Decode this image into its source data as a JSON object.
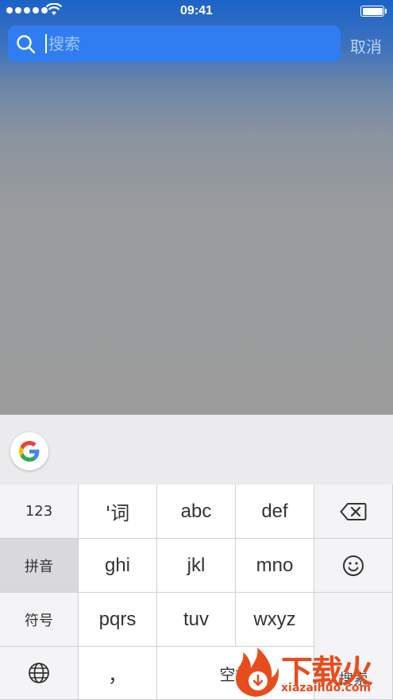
{
  "status_bar": {
    "time": "09:41"
  },
  "search": {
    "placeholder": "搜索",
    "value": "",
    "cancel_label": "取消"
  },
  "keyboard": {
    "rows": [
      [
        "123",
        "'词",
        "abc",
        "def"
      ],
      [
        "拼音",
        "ghi",
        "jkl",
        "mno"
      ],
      [
        "符号",
        "pqrs",
        "tuv",
        "wxyz"
      ],
      [
        "",
        "，",
        "空格"
      ]
    ],
    "search_key_label": "搜索"
  },
  "watermark": {
    "text": "下载火",
    "sub": "xiazaihuo.com"
  },
  "colors": {
    "accent": "#2f7df0",
    "google_blue": "#4285F4",
    "google_red": "#EA4335",
    "google_yellow": "#FBBC05",
    "google_green": "#34A853",
    "watermark": "#e84c1d"
  }
}
